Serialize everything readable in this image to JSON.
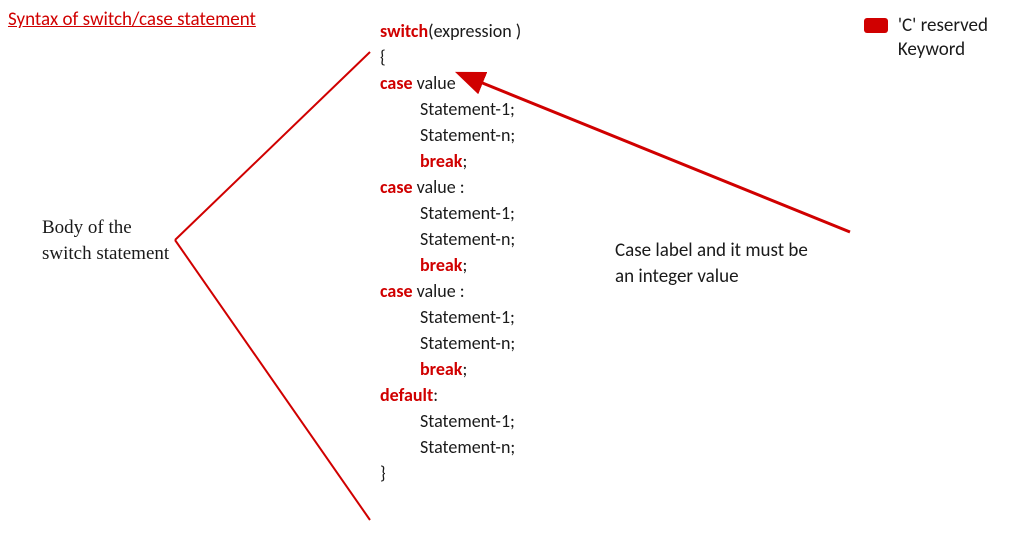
{
  "title": "Syntax of switch/case statement",
  "legend": {
    "text1": "'C' reserved",
    "text2": "Keyword"
  },
  "labels": {
    "body_line1": "Body of the",
    "body_line2": "switch statement",
    "case_line1": "Case label and it must be",
    "case_line2": "an integer value"
  },
  "code": {
    "switch": "switch",
    "expr_open": "(expression )",
    "brace_open": "{",
    "case": "case",
    "value": " value",
    "colon": " :",
    "stmt1": "Statement-1;",
    "stmtn": "Statement-n;",
    "break": "break",
    "semicolon": ";",
    "default": "default",
    "def_colon": ":",
    "brace_close": "}"
  },
  "colors": {
    "red": "#d00000",
    "black": "#1a1a1a"
  }
}
